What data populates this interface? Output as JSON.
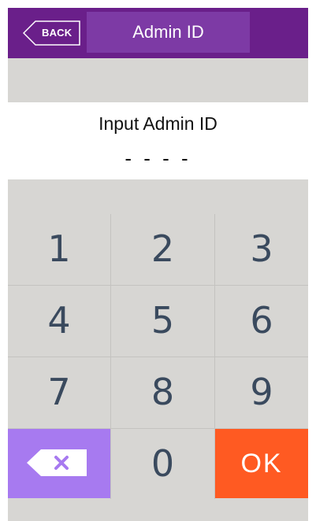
{
  "header": {
    "back_label": "BACK",
    "title": "Admin ID"
  },
  "prompt": {
    "text": "Input Admin ID",
    "id_mask": "- - - -"
  },
  "keypad": {
    "keys": [
      "1",
      "2",
      "3",
      "4",
      "5",
      "6",
      "7",
      "8",
      "9"
    ],
    "zero": "0",
    "ok": "OK",
    "backspace_icon": "backspace-icon"
  },
  "colors": {
    "header": "#6a1f8a",
    "title_box": "#7d3aa5",
    "panel": "#d7d6d3",
    "backspace_key": "#a77af0",
    "ok_key": "#ff5a22",
    "digit_text": "#3a4a5e"
  }
}
